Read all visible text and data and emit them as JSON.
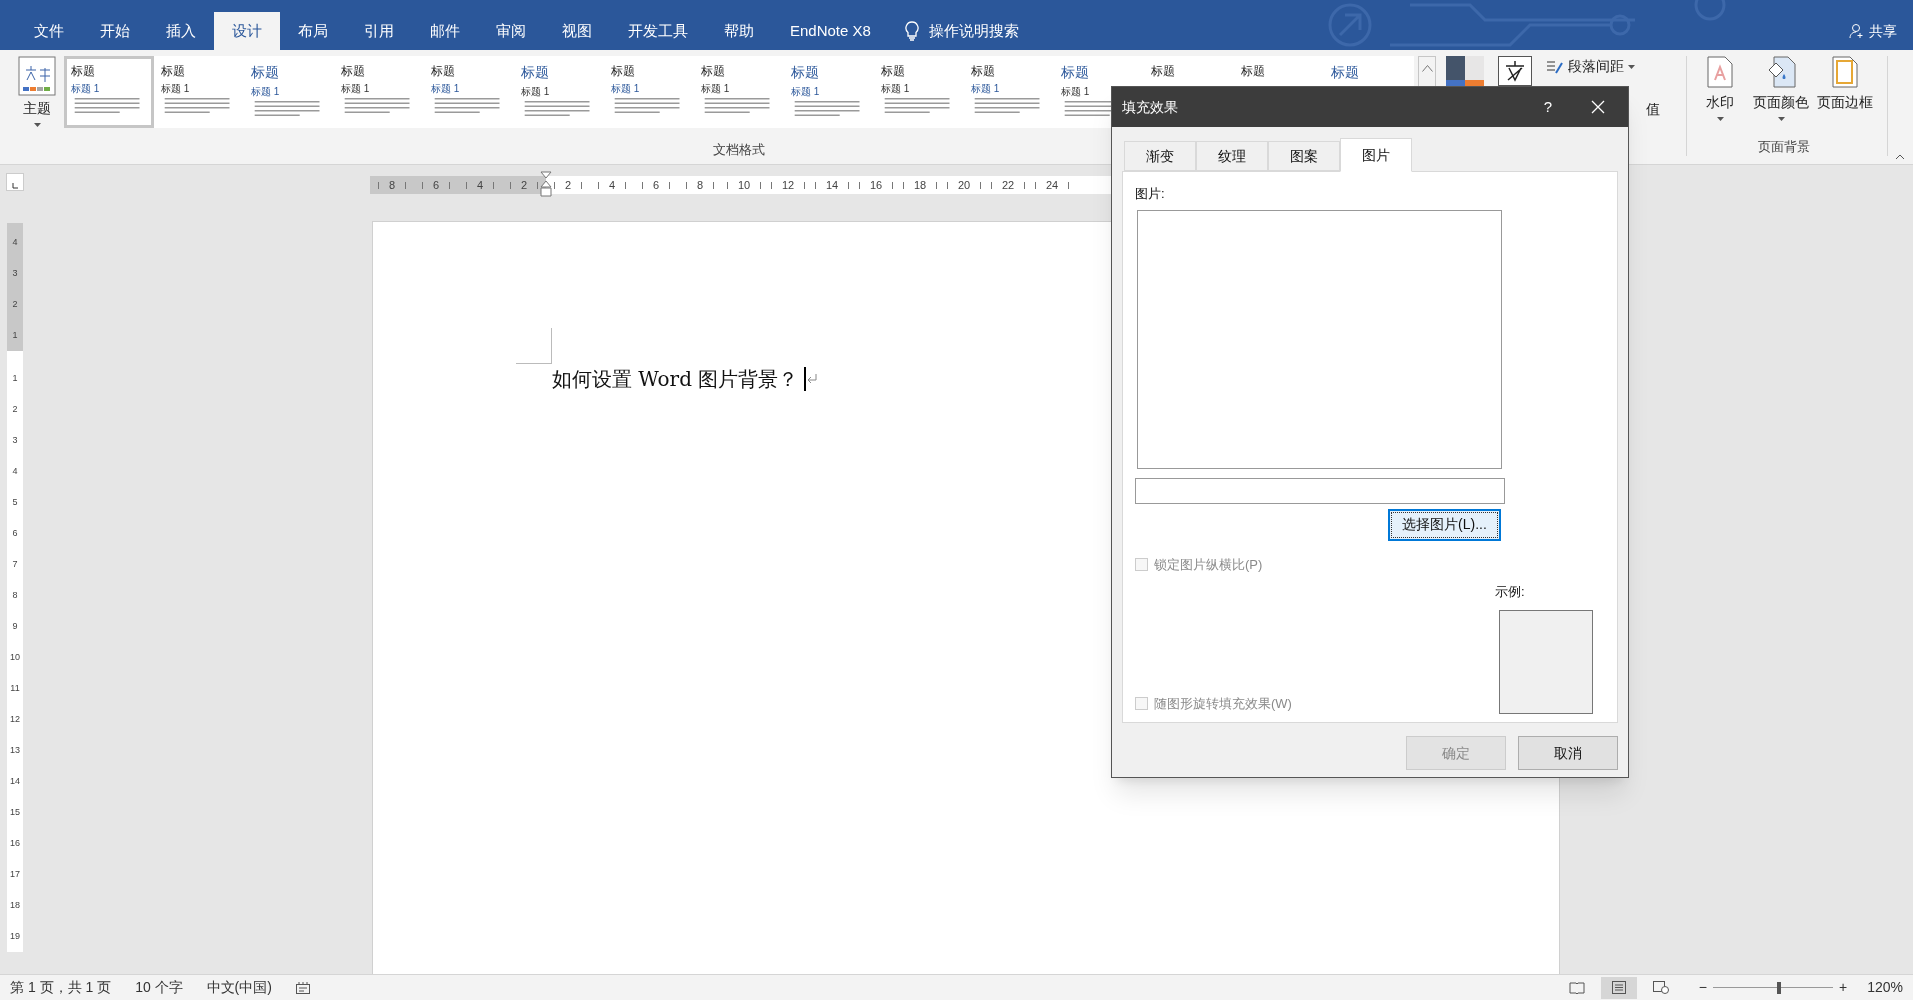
{
  "menu_tabs": [
    {
      "label": "文件",
      "selected": false
    },
    {
      "label": "开始",
      "selected": false
    },
    {
      "label": "插入",
      "selected": false
    },
    {
      "label": "设计",
      "selected": true
    },
    {
      "label": "布局",
      "selected": false
    },
    {
      "label": "引用",
      "selected": false
    },
    {
      "label": "邮件",
      "selected": false
    },
    {
      "label": "审阅",
      "selected": false
    },
    {
      "label": "视图",
      "selected": false
    },
    {
      "label": "开发工具",
      "selected": false
    },
    {
      "label": "帮助",
      "selected": false
    },
    {
      "label": "EndNote X8",
      "selected": false
    }
  ],
  "tell_me": "操作说明搜索",
  "share": "共享",
  "theme_button": "主题",
  "style_gallery": {
    "label": "文档格式",
    "items": [
      {
        "title": "标题",
        "subtitle": "标题 1",
        "selected": true
      },
      {
        "title": "标题",
        "subtitle": "标题 1",
        "selected": false
      },
      {
        "title": "标题",
        "subtitle": "标题 1",
        "selected": false
      },
      {
        "title": "标题",
        "subtitle": "标题 1",
        "selected": false
      },
      {
        "title": "标题",
        "subtitle": "标题 1",
        "selected": false
      },
      {
        "title": "标题",
        "subtitle": "标题 1",
        "selected": false
      },
      {
        "title": "标题",
        "subtitle": "标题 1",
        "selected": false
      },
      {
        "title": "标题",
        "subtitle": "标题 1",
        "selected": false
      },
      {
        "title": "标题",
        "subtitle": "标题 1",
        "selected": false
      },
      {
        "title": "标题",
        "subtitle": "标题 1",
        "selected": false
      },
      {
        "title": "标题",
        "subtitle": "标题 1",
        "selected": false
      },
      {
        "title": "标题",
        "subtitle": "标题 1",
        "selected": false
      },
      {
        "title": "标题",
        "selected": false
      },
      {
        "title": "标题",
        "selected": false
      },
      {
        "title": "标题",
        "selected": false
      }
    ]
  },
  "paragraph_spacing": "段落间距",
  "set_default_fragment": "值",
  "page_background": {
    "label": "页面背景",
    "buttons": [
      {
        "kind": "watermark",
        "label": "水印"
      },
      {
        "kind": "color",
        "label": "页面颜色"
      },
      {
        "kind": "border",
        "label": "页面边框"
      }
    ]
  },
  "ruler": {
    "left_numbers": [
      "8",
      "6",
      "4",
      "2"
    ],
    "right_numbers": [
      "2",
      "4",
      "6",
      "8",
      "10",
      "12",
      "14",
      "16",
      "18",
      "20",
      "22",
      "24"
    ]
  },
  "vertical_ruler": {
    "top_numbers": [
      "4",
      "3",
      "2",
      "1"
    ],
    "numbers": [
      "1",
      "2",
      "3",
      "4",
      "5",
      "6",
      "7",
      "8",
      "9",
      "10",
      "11",
      "12",
      "13",
      "14",
      "15",
      "16",
      "17",
      "18",
      "19"
    ]
  },
  "document": {
    "text": "如何设置 Word 图片背景？"
  },
  "dialog": {
    "title": "填充效果",
    "help": "?",
    "tabs": [
      {
        "label": "渐变",
        "selected": false
      },
      {
        "label": "纹理",
        "selected": false
      },
      {
        "label": "图案",
        "selected": false
      },
      {
        "label": "图片",
        "selected": true
      }
    ],
    "picture_label": "图片:",
    "choose_button": "选择图片(L)...",
    "lock_checkbox": {
      "label": "锁定图片纵横比(P)",
      "checked": false,
      "disabled": true
    },
    "rotate_checkbox": {
      "label": "随图形旋转填充效果(W)",
      "checked": false,
      "disabled": true
    },
    "sample_label": "示例:",
    "buttons": [
      {
        "label": "确定",
        "disabled": true
      },
      {
        "label": "取消",
        "disabled": false
      }
    ]
  },
  "status_bar": {
    "page": "第 1 页，共 1 页",
    "words": "10 个字",
    "language": "中文(中国)",
    "views": [
      {
        "kind": "read",
        "selected": false
      },
      {
        "kind": "print",
        "selected": true
      },
      {
        "kind": "web",
        "selected": false
      }
    ],
    "zoom_minus": "−",
    "zoom_plus": "+",
    "zoom": "120%",
    "zoom_slider": {
      "level": 0.53
    }
  }
}
